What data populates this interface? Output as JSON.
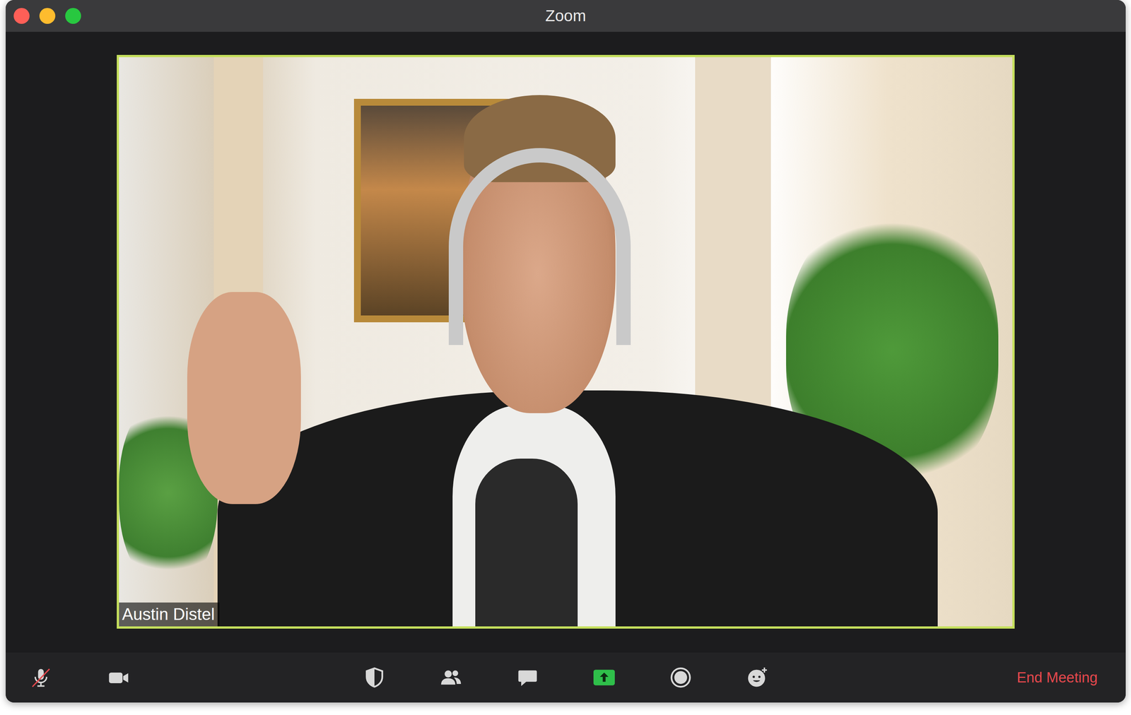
{
  "window": {
    "title": "Zoom"
  },
  "video": {
    "participant": "Austin Distel"
  },
  "toolbar": {
    "microphone_muted": true,
    "end_meeting": "End Meeting"
  }
}
